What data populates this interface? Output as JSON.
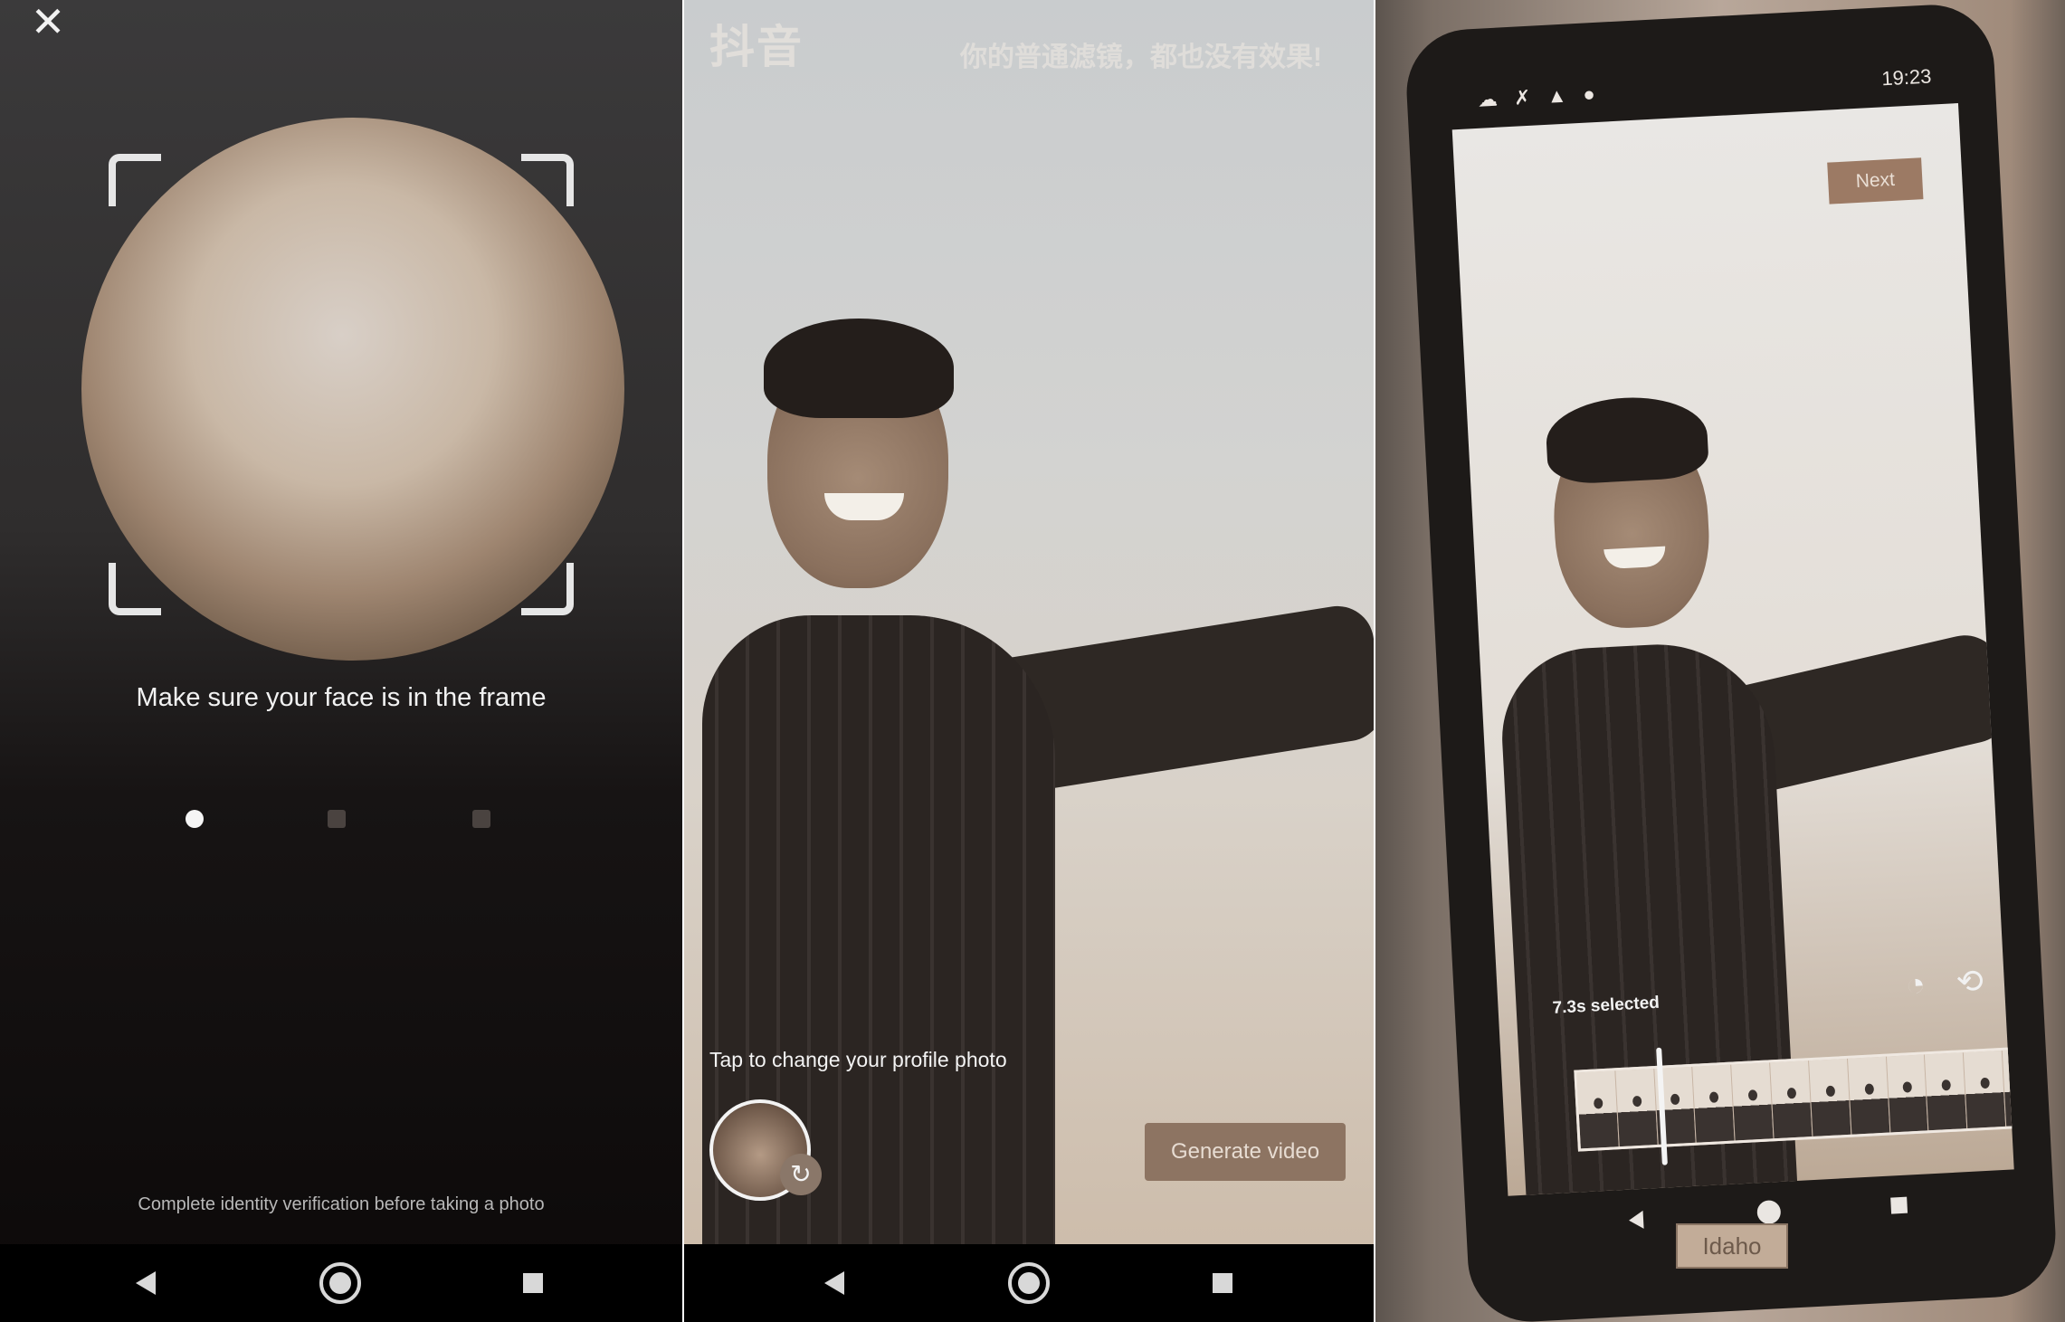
{
  "panel1": {
    "close_label": "✕",
    "instruction": "Make sure your face is in the frame",
    "footnote": "Complete identity verification before taking a photo",
    "progress": {
      "current_step": 1,
      "total_steps": 3
    }
  },
  "panel2": {
    "top_text": "你的普通滤镜，都也没有效果!",
    "logo_text": "抖音",
    "tap_text": "Tap to change your profile photo",
    "switch_icon": "↻",
    "generate_label": "Generate video"
  },
  "panel3": {
    "status_left": "☁ ✗ ▲ ●",
    "status_time": "19:23",
    "next_label": "Next",
    "selected_text": "7.3s selected",
    "sticker_text": "Idaho",
    "tool_icons": [
      "speed-icon",
      "rotate-icon"
    ],
    "tool_glyphs": [
      "◔",
      "⟲"
    ]
  },
  "nav": {
    "back": "back",
    "home": "home",
    "recent": "recent"
  }
}
